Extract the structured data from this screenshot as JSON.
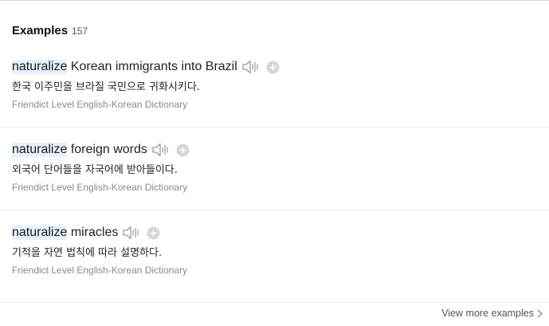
{
  "examples_section": {
    "title": "Examples",
    "count": "157",
    "view_more_label": "View more examples"
  },
  "examples": [
    {
      "keyword": "naturalize",
      "rest": " Korean immigrants into Brazil",
      "translation": "한국 이주민을 브라질 국민으로 귀화시키다.",
      "source": "Friendict Level English-Korean Dictionary"
    },
    {
      "keyword": "naturalize",
      "rest": " foreign words",
      "translation": "외국어 단어들을 자국어에 받아들이다.",
      "source": "Friendict Level English-Korean Dictionary"
    },
    {
      "keyword": "naturalize",
      "rest": " miracles",
      "translation": "기적을 자연 법칙에 따라 설명하다.",
      "source": "Friendict Level English-Korean Dictionary"
    }
  ],
  "icons": {
    "speaker": "speaker-icon",
    "add": "plus-circle-icon",
    "chevron": "chevron-right-icon"
  },
  "colors": {
    "highlight": "#e6f1fb",
    "icon_gray": "#9a9a9a",
    "add_gray": "#d6d6d6"
  }
}
